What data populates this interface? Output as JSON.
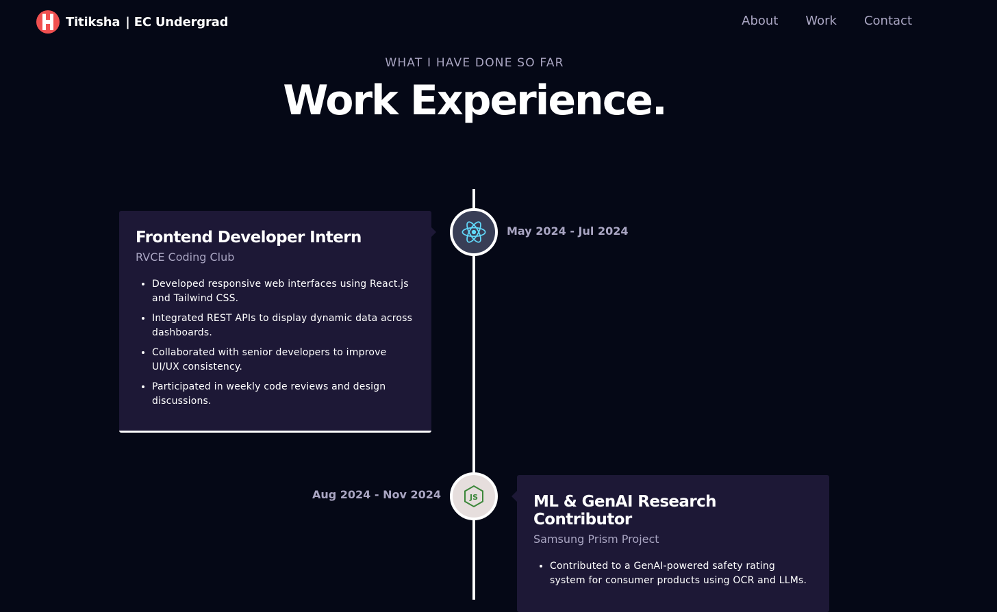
{
  "nav": {
    "brand_name": "Titiksha",
    "brand_tag": "| EC Undergrad",
    "links": [
      "About",
      "Work",
      "Contact"
    ]
  },
  "section": {
    "subtitle": "WHAT I HAVE DONE SO FAR",
    "title": "Work Experience."
  },
  "experiences": [
    {
      "title": "Frontend Developer Intern",
      "company": "RVCE Coding Club",
      "date": "May 2024 - Jul 2024",
      "icon": "react-icon",
      "points": [
        "Developed responsive web interfaces using React.js and Tailwind CSS.",
        "Integrated REST APIs to display dynamic data across dashboards.",
        "Collaborated with senior developers to improve UI/UX consistency.",
        "Participated in weekly code reviews and design discussions."
      ]
    },
    {
      "title": "ML & GenAI Research Contributor",
      "company": "Samsung Prism Project",
      "date": "Aug 2024 - Nov 2024",
      "icon": "nodejs-icon",
      "points": [
        "Contributed to a GenAI-powered safety rating system for consumer products using OCR and LLMs."
      ]
    }
  ],
  "colors": {
    "background": "#050816",
    "card": "#1d1836",
    "secondary_text": "#aaa6c3",
    "logo_red": "#f05050",
    "react_blue": "#61dafb",
    "node_green": "#3c873a"
  }
}
